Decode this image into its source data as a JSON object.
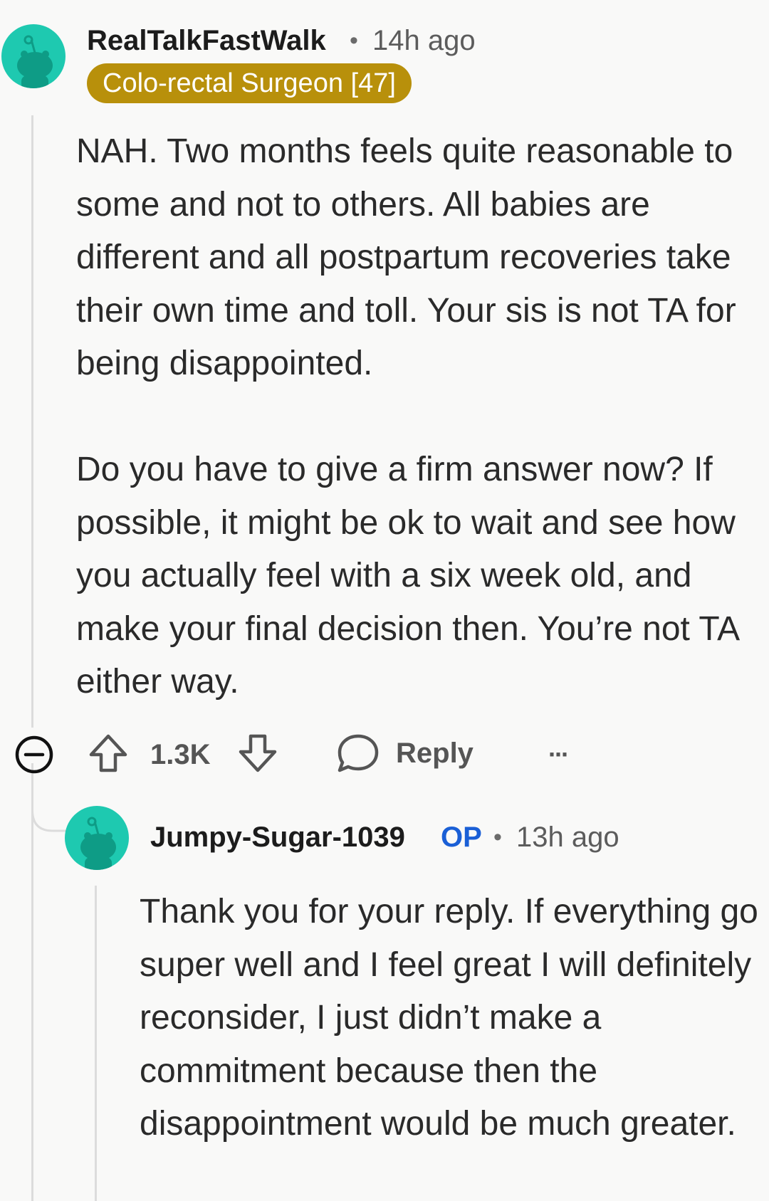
{
  "comment": {
    "author": "RealTalkFastWalk",
    "separator": "•",
    "time": "14h ago",
    "flair": "Colo-rectal Surgeon [47]",
    "flair_color": "#b8900b",
    "avatar_color": "#1ec9b0",
    "paragraphs": [
      "NAH. Two months feels quite reasonable to some and not to others. All babies are different and all postpartum recoveries take their own time and toll. Your sis is not TA for being disappointed.",
      "Do you have to give a firm answer now? If possible, it might be ok to wait and see how you actually feel with a six week old, and make your final decision then. You’re not TA either way."
    ],
    "actions": {
      "collapse_icon": "minus-circle-icon",
      "upvote_icon": "arrow-up-icon",
      "score": "1.3K",
      "downvote_icon": "arrow-down-icon",
      "reply_icon": "speech-bubble-icon",
      "reply_label": "Reply",
      "more_icon": "ellipsis-icon",
      "more_label": "···"
    }
  },
  "reply": {
    "author": "Jumpy-Sugar-1039",
    "op_badge": "OP",
    "op_color": "#1a5fd6",
    "separator": "•",
    "time": "13h ago",
    "avatar_color": "#1ec9b0",
    "paragraphs": [
      "Thank you for your reply. If everything go super well and I feel great I will definitely reconsider, I just didn’t make a commitment because then the disappointment would be much greater."
    ]
  }
}
